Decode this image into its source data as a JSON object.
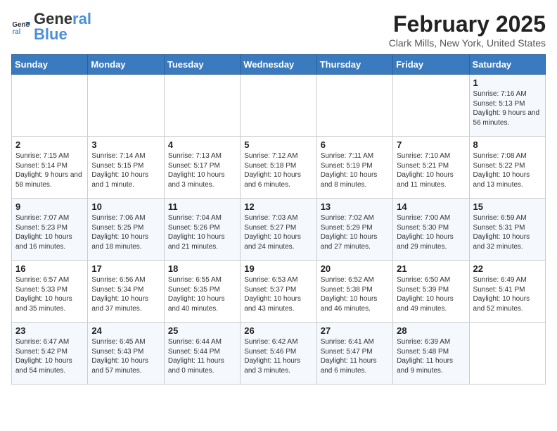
{
  "header": {
    "logo_general": "General",
    "logo_blue": "Blue",
    "month_title": "February 2025",
    "location": "Clark Mills, New York, United States"
  },
  "days_of_week": [
    "Sunday",
    "Monday",
    "Tuesday",
    "Wednesday",
    "Thursday",
    "Friday",
    "Saturday"
  ],
  "weeks": [
    [
      {
        "num": "",
        "info": ""
      },
      {
        "num": "",
        "info": ""
      },
      {
        "num": "",
        "info": ""
      },
      {
        "num": "",
        "info": ""
      },
      {
        "num": "",
        "info": ""
      },
      {
        "num": "",
        "info": ""
      },
      {
        "num": "1",
        "info": "Sunrise: 7:16 AM\nSunset: 5:13 PM\nDaylight: 9 hours and 56 minutes."
      }
    ],
    [
      {
        "num": "2",
        "info": "Sunrise: 7:15 AM\nSunset: 5:14 PM\nDaylight: 9 hours and 58 minutes."
      },
      {
        "num": "3",
        "info": "Sunrise: 7:14 AM\nSunset: 5:15 PM\nDaylight: 10 hours and 1 minute."
      },
      {
        "num": "4",
        "info": "Sunrise: 7:13 AM\nSunset: 5:17 PM\nDaylight: 10 hours and 3 minutes."
      },
      {
        "num": "5",
        "info": "Sunrise: 7:12 AM\nSunset: 5:18 PM\nDaylight: 10 hours and 6 minutes."
      },
      {
        "num": "6",
        "info": "Sunrise: 7:11 AM\nSunset: 5:19 PM\nDaylight: 10 hours and 8 minutes."
      },
      {
        "num": "7",
        "info": "Sunrise: 7:10 AM\nSunset: 5:21 PM\nDaylight: 10 hours and 11 minutes."
      },
      {
        "num": "8",
        "info": "Sunrise: 7:08 AM\nSunset: 5:22 PM\nDaylight: 10 hours and 13 minutes."
      }
    ],
    [
      {
        "num": "9",
        "info": "Sunrise: 7:07 AM\nSunset: 5:23 PM\nDaylight: 10 hours and 16 minutes."
      },
      {
        "num": "10",
        "info": "Sunrise: 7:06 AM\nSunset: 5:25 PM\nDaylight: 10 hours and 18 minutes."
      },
      {
        "num": "11",
        "info": "Sunrise: 7:04 AM\nSunset: 5:26 PM\nDaylight: 10 hours and 21 minutes."
      },
      {
        "num": "12",
        "info": "Sunrise: 7:03 AM\nSunset: 5:27 PM\nDaylight: 10 hours and 24 minutes."
      },
      {
        "num": "13",
        "info": "Sunrise: 7:02 AM\nSunset: 5:29 PM\nDaylight: 10 hours and 27 minutes."
      },
      {
        "num": "14",
        "info": "Sunrise: 7:00 AM\nSunset: 5:30 PM\nDaylight: 10 hours and 29 minutes."
      },
      {
        "num": "15",
        "info": "Sunrise: 6:59 AM\nSunset: 5:31 PM\nDaylight: 10 hours and 32 minutes."
      }
    ],
    [
      {
        "num": "16",
        "info": "Sunrise: 6:57 AM\nSunset: 5:33 PM\nDaylight: 10 hours and 35 minutes."
      },
      {
        "num": "17",
        "info": "Sunrise: 6:56 AM\nSunset: 5:34 PM\nDaylight: 10 hours and 37 minutes."
      },
      {
        "num": "18",
        "info": "Sunrise: 6:55 AM\nSunset: 5:35 PM\nDaylight: 10 hours and 40 minutes."
      },
      {
        "num": "19",
        "info": "Sunrise: 6:53 AM\nSunset: 5:37 PM\nDaylight: 10 hours and 43 minutes."
      },
      {
        "num": "20",
        "info": "Sunrise: 6:52 AM\nSunset: 5:38 PM\nDaylight: 10 hours and 46 minutes."
      },
      {
        "num": "21",
        "info": "Sunrise: 6:50 AM\nSunset: 5:39 PM\nDaylight: 10 hours and 49 minutes."
      },
      {
        "num": "22",
        "info": "Sunrise: 6:49 AM\nSunset: 5:41 PM\nDaylight: 10 hours and 52 minutes."
      }
    ],
    [
      {
        "num": "23",
        "info": "Sunrise: 6:47 AM\nSunset: 5:42 PM\nDaylight: 10 hours and 54 minutes."
      },
      {
        "num": "24",
        "info": "Sunrise: 6:45 AM\nSunset: 5:43 PM\nDaylight: 10 hours and 57 minutes."
      },
      {
        "num": "25",
        "info": "Sunrise: 6:44 AM\nSunset: 5:44 PM\nDaylight: 11 hours and 0 minutes."
      },
      {
        "num": "26",
        "info": "Sunrise: 6:42 AM\nSunset: 5:46 PM\nDaylight: 11 hours and 3 minutes."
      },
      {
        "num": "27",
        "info": "Sunrise: 6:41 AM\nSunset: 5:47 PM\nDaylight: 11 hours and 6 minutes."
      },
      {
        "num": "28",
        "info": "Sunrise: 6:39 AM\nSunset: 5:48 PM\nDaylight: 11 hours and 9 minutes."
      },
      {
        "num": "",
        "info": ""
      }
    ]
  ]
}
